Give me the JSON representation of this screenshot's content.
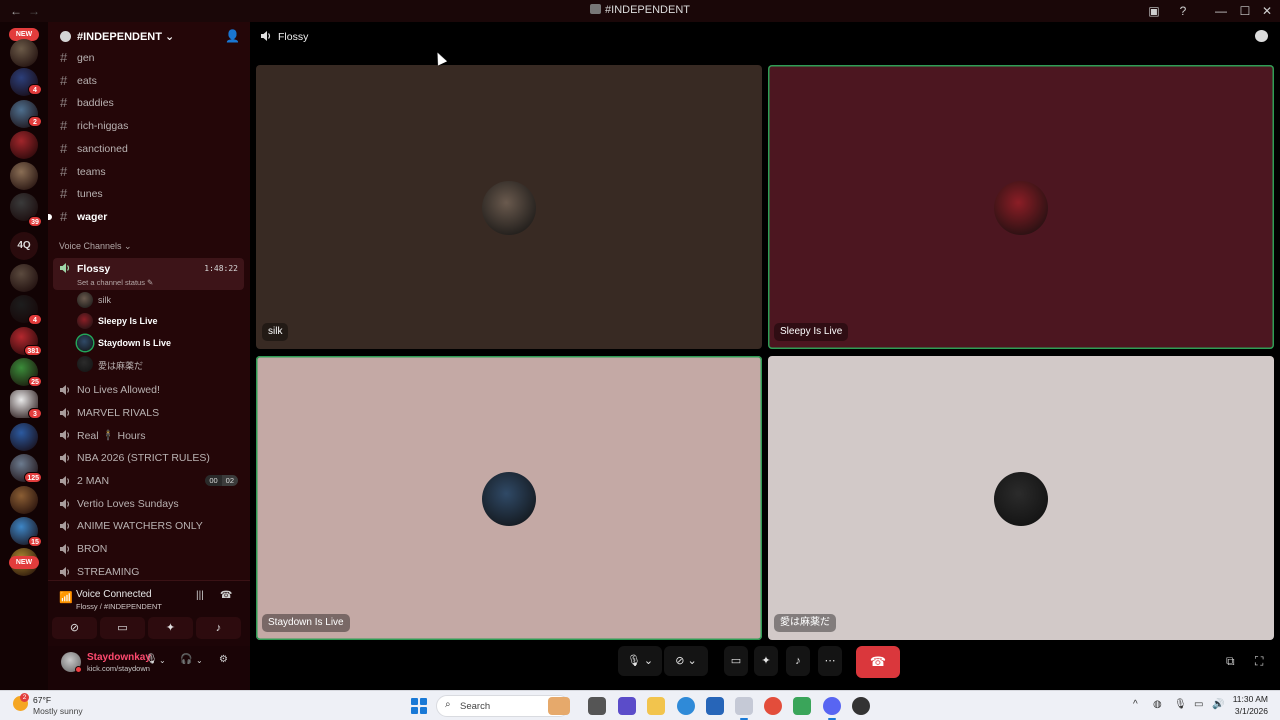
{
  "window": {
    "title": "#INDEPENDENT",
    "nav_back": "←",
    "nav_forward": "→",
    "controls": [
      "—",
      "☐",
      "✕"
    ]
  },
  "server": {
    "name": "#INDEPENDENT",
    "chevron": "⌄",
    "add_member_icon": "add-user-icon"
  },
  "rail": {
    "new_top": "NEW",
    "new_bottom": "NEW",
    "text_server": "4Q",
    "badges": [
      "4",
      "2",
      "39",
      "4",
      "381",
      "25",
      "3",
      "125",
      "15"
    ],
    "colors": [
      "#6b5a48",
      "#2c3f7a",
      "#4e6f8e",
      "#a1262b",
      "#8a6e55",
      "#3a3a3a",
      "#2c2c2c",
      "#5b4a3e",
      "#1d1d1d",
      "#b4282e",
      "#3b8c3a",
      "#e9e9e9",
      "#2c5aa0",
      "#6c7b8f",
      "#8b5e34",
      "#3e86c6",
      "#a9852f"
    ]
  },
  "text_channels": [
    {
      "name": "gen",
      "unread": false
    },
    {
      "name": "eats",
      "unread": false
    },
    {
      "name": "baddies",
      "unread": false
    },
    {
      "name": "rich-niggas",
      "unread": false
    },
    {
      "name": "sanctioned",
      "unread": false
    },
    {
      "name": "teams",
      "unread": false
    },
    {
      "name": "tunes",
      "unread": false
    },
    {
      "name": "wager",
      "unread": true
    }
  ],
  "voice_category": "Voice Channels",
  "active_voice": {
    "name": "Flossy",
    "timer": "1:48:22",
    "status_hint": "Set a channel status",
    "members": [
      {
        "name": "silk",
        "speaking": false,
        "color": "#6a5a4e"
      },
      {
        "name": "Sleepy Is Live",
        "speaking": false,
        "color": "#8c1e26"
      },
      {
        "name": "Staydown Is Live",
        "speaking": true,
        "color": "#304a67"
      },
      {
        "name": "愛は麻薬だ",
        "speaking": false,
        "color": "#2b2b2b"
      }
    ]
  },
  "voice_channels": [
    {
      "name": "No Lives Allowed!"
    },
    {
      "name": "MARVEL RIVALS"
    },
    {
      "name": "Real 🕴 Hours"
    },
    {
      "name": "NBA 2026 (STRICT RULES)"
    },
    {
      "name": "2 MAN",
      "counter": [
        "00",
        "02"
      ]
    },
    {
      "name": "Vertio Loves Sundays"
    },
    {
      "name": "ANIME WATCHERS ONLY"
    },
    {
      "name": "BRON"
    },
    {
      "name": "STREAMING"
    }
  ],
  "voice_panel": {
    "title": "Voice Connected",
    "subtitle": "Flossy / #INDEPENDENT",
    "buttons": [
      "camera-off-icon",
      "screen-share-icon",
      "activities-icon",
      "soundboard-icon"
    ]
  },
  "user": {
    "name": "Staydownkay",
    "status": "kick.com/staydown"
  },
  "main": {
    "channel": "Flossy",
    "tiles": [
      {
        "name": "silk",
        "bg": "#382a23",
        "avatar": "#6a5a4e",
        "speaking": false
      },
      {
        "name": "Sleepy Is Live",
        "bg": "#4c1620",
        "avatar": "#8c1e26",
        "speaking": true
      },
      {
        "name": "Staydown Is Live",
        "bg": "#c4a9a5",
        "avatar": "#304a67",
        "speaking": true
      },
      {
        "name": "愛は麻薬だ",
        "bg": "#d2c9c8",
        "avatar": "#2b2b2b",
        "speaking": false
      }
    ],
    "hangup_icon": "phone-hangup-icon"
  },
  "taskbar": {
    "temp": "67°F",
    "condition": "Mostly sunny",
    "weather_badge": "2",
    "search_placeholder": "Search",
    "time": "11:30 AM",
    "date": "3/1/2026",
    "tray_expand": "^"
  }
}
